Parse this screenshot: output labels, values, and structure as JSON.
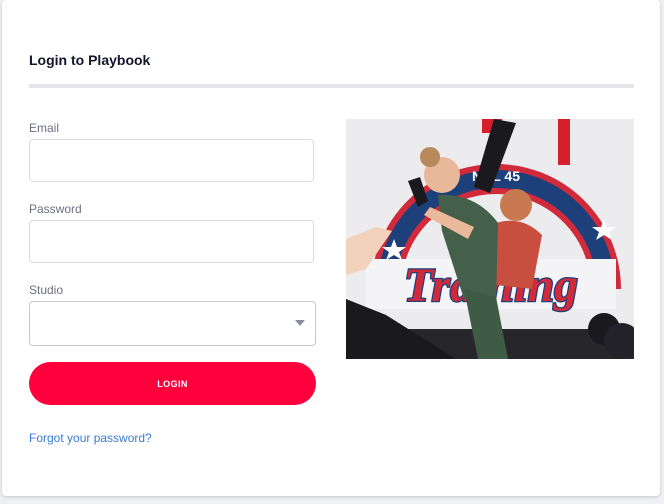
{
  "login": {
    "title": "Login to Playbook",
    "email_label": "Email",
    "email_value": "",
    "password_label": "Password",
    "password_value": "",
    "studio_label": "Studio",
    "studio_value": "",
    "login_button": "LOGIN",
    "forgot_link": "Forgot your password?"
  },
  "hero_image": {
    "sign_text": "Training",
    "arch_text": "NAL 45"
  },
  "colors": {
    "accent": "#ff003c",
    "link": "#3a7bd5",
    "title": "#14142b",
    "label": "#6c6f82"
  }
}
